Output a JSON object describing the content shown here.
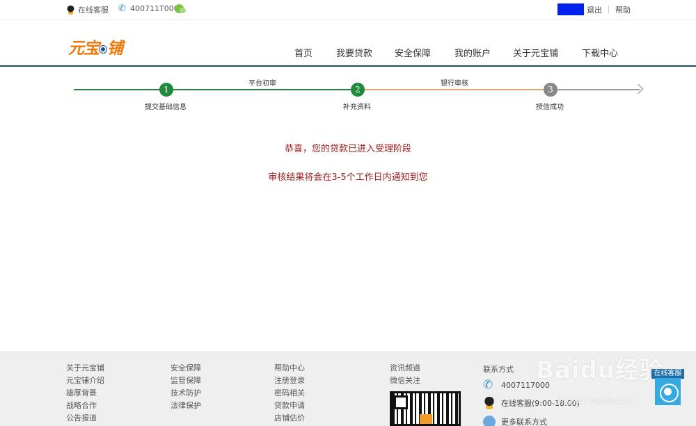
{
  "topbar": {
    "online_service": "在线客服",
    "phone": "400711T000",
    "logout": "退出",
    "help": "帮助"
  },
  "header": {
    "logo_text_1": "元宝",
    "logo_text_2": "铺",
    "nav": [
      "首页",
      "我要贷款",
      "安全保障",
      "我的账户",
      "关于元宝铺",
      "下载中心"
    ]
  },
  "progress": {
    "steps": [
      {
        "number": "1",
        "label": "提交基础信息"
      },
      {
        "number": "2",
        "label": "补充资料"
      },
      {
        "number": "3",
        "label": "授信成功"
      }
    ],
    "phases": [
      "平台初审",
      "银行审核"
    ]
  },
  "message": {
    "line1": "恭喜，您的贷款已进入受理阶段",
    "line2": "审核结果将会在3-5个工作日内通知到您"
  },
  "footer": {
    "col1": [
      "关于元宝铺",
      "元宝铺介绍",
      "雄厚背景",
      "战略合作",
      "公告报道"
    ],
    "col2": [
      "安全保障",
      "监管保障",
      "技术防护",
      "法律保护"
    ],
    "col3": [
      "帮助中心",
      "注册登录",
      "密码相关",
      "贷款申请",
      "店铺估价"
    ],
    "col4": [
      "资讯频道",
      "微信关注"
    ],
    "contact_title": "联系方式",
    "contact_phone": "4007117000",
    "contact_online": "在线客服(9:00-18:00)",
    "contact_more": "更多联系方式"
  },
  "chat_widget": {
    "label": "在线客服"
  },
  "watermark": {
    "text": "Baidu经验",
    "url": "jingyan.baidu.com"
  }
}
